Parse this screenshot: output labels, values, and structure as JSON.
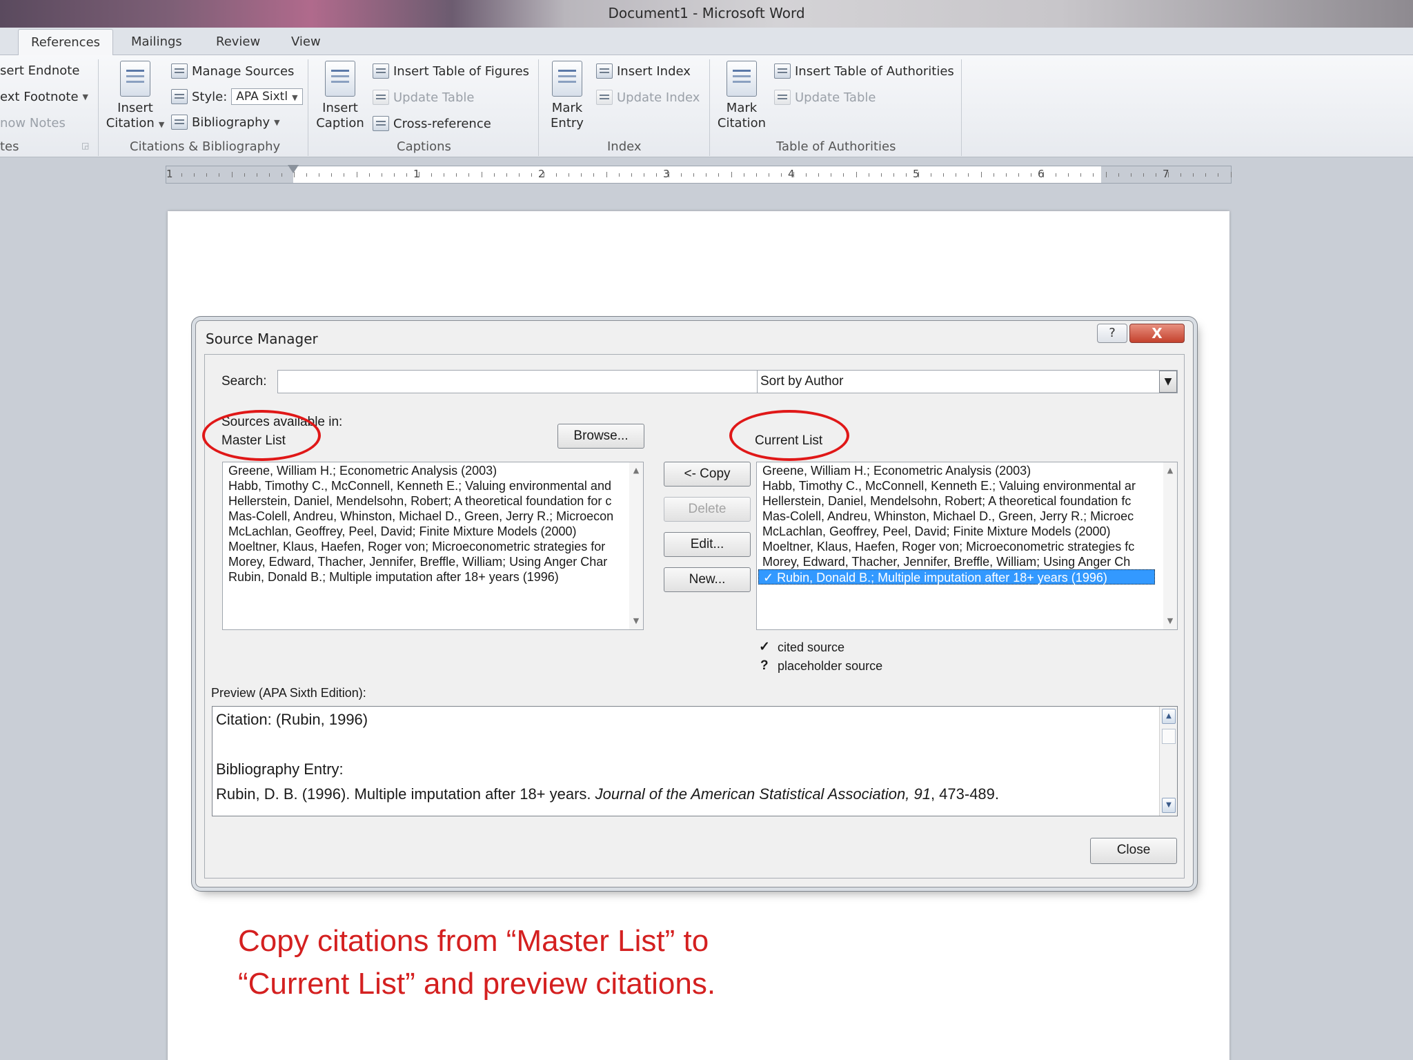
{
  "window": {
    "title": "Document1  -  Microsoft Word"
  },
  "ribbon": {
    "tabs": [
      {
        "label": "References",
        "active": true
      },
      {
        "label": "Mailings"
      },
      {
        "label": "Review"
      },
      {
        "label": "View"
      }
    ],
    "footnotes": {
      "insert_endnote": "sert Endnote",
      "next_footnote": "ext Footnote",
      "show_notes": "now Notes",
      "group": "tes"
    },
    "citations": {
      "insert_citation_line1": "Insert",
      "insert_citation_line2": "Citation",
      "manage_sources": "Manage Sources",
      "style_label": "Style:",
      "style_value": "APA Sixtl",
      "bibliography": "Bibliography",
      "group": "Citations & Bibliography"
    },
    "captions": {
      "insert_caption_line1": "Insert",
      "insert_caption_line2": "Caption",
      "insert_table_of_figures": "Insert Table of Figures",
      "update_table": "Update Table",
      "cross_reference": "Cross-reference",
      "group": "Captions"
    },
    "index": {
      "mark_entry_line1": "Mark",
      "mark_entry_line2": "Entry",
      "insert_index": "Insert Index",
      "update_index": "Update Index",
      "group": "Index"
    },
    "authorities": {
      "mark_citation_line1": "Mark",
      "mark_citation_line2": "Citation",
      "insert_table_of_authorities": "Insert Table of Authorities",
      "update_table": "Update Table",
      "group": "Table of Authorities"
    }
  },
  "ruler": {
    "numbers": [
      "1",
      "1",
      "2",
      "3",
      "4",
      "5",
      "6",
      "7"
    ]
  },
  "dialog": {
    "title": "Source Manager",
    "help_glyph": "?",
    "close_glyph": "X",
    "search_label": "Search:",
    "search_value": "",
    "sort_value": "Sort by Author",
    "sources_label": "Sources available in:",
    "master_list_label": "Master List",
    "browse_button": "Browse...",
    "current_list_label": "Current List",
    "copy_button": "<- Copy",
    "delete_button": "Delete",
    "edit_button": "Edit...",
    "new_button": "New...",
    "master_items": [
      "Greene, William H.; Econometric Analysis (2003)",
      "Habb, Timothy C., McConnell, Kenneth E.; Valuing environmental and",
      "Hellerstein, Daniel, Mendelsohn, Robert; A theoretical foundation for c",
      "Mas-Colell, Andreu, Whinston, Michael D., Green, Jerry R.; Microecon",
      "McLachlan, Geoffrey, Peel, David; Finite Mixture Models (2000)",
      "Moeltner, Klaus, Haefen, Roger von; Microeconometric strategies for",
      "Morey, Edward, Thacher, Jennifer, Breffle, William; Using Anger Char",
      "Rubin, Donald B.; Multiple imputation after 18+ years (1996)"
    ],
    "current_items": [
      "Greene, William H.; Econometric Analysis (2003)",
      "Habb, Timothy C., McConnell, Kenneth E.; Valuing environmental ar",
      "Hellerstein, Daniel, Mendelsohn, Robert; A theoretical foundation fc",
      "Mas-Colell, Andreu, Whinston, Michael D., Green, Jerry R.; Microec",
      "McLachlan, Geoffrey, Peel, David; Finite Mixture Models (2000)",
      "Moeltner, Klaus, Haefen, Roger von; Microeconometric strategies fc",
      "Morey, Edward, Thacher, Jennifer, Breffle, William; Using Anger Ch",
      "✓ Rubin, Donald B.; Multiple imputation after 18+ years (1996)"
    ],
    "selected_current_index": 7,
    "legend": [
      {
        "glyph": "✓",
        "text": "cited source"
      },
      {
        "glyph": "?",
        "text": "placeholder source"
      }
    ],
    "preview_label": "Preview (APA Sixth Edition):",
    "preview": {
      "citation": "Citation:  (Rubin, 1996)",
      "bibliography_heading": "Bibliography Entry:",
      "bibliography_plain": "Rubin, D. B. (1996). Multiple imputation after 18+ years. ",
      "bibliography_italic": "Journal of the American Statistical Association, 91",
      "bibliography_tail": ", 473-489."
    },
    "close_button": "Close"
  },
  "caption": {
    "line1": "Copy citations from “Master List” to",
    "line2": "“Current List” and preview citations."
  },
  "colors": {
    "annotation_red": "#e01818",
    "selection_blue": "#3399ff",
    "caption_red": "#d42020"
  }
}
